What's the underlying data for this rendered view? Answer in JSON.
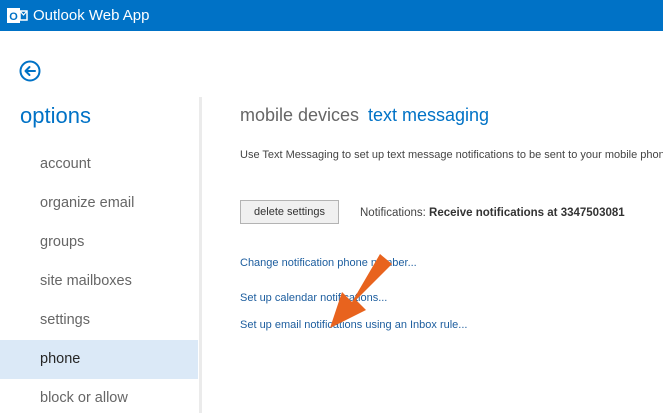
{
  "app": {
    "title": "Outlook Web App",
    "logo": "outlook-logo",
    "brand_color": "#0072c6"
  },
  "back": {
    "icon": "back-arrow-icon"
  },
  "sidebar": {
    "title": "options",
    "items": [
      {
        "label": "account",
        "selected": false
      },
      {
        "label": "organize email",
        "selected": false
      },
      {
        "label": "groups",
        "selected": false
      },
      {
        "label": "site mailboxes",
        "selected": false
      },
      {
        "label": "settings",
        "selected": false
      },
      {
        "label": "phone",
        "selected": true
      },
      {
        "label": "block or allow",
        "selected": false
      }
    ],
    "selected_color": "#dbe9f7"
  },
  "main": {
    "tabs": [
      {
        "label": "mobile devices",
        "active": false
      },
      {
        "label": "text messaging",
        "active": true
      }
    ],
    "intro": "Use Text Messaging to set up text message notifications to be sent to your mobile phone.",
    "delete_button": "delete settings",
    "notifications_label": "Notifications:",
    "notifications_value": "Receive notifications at 3347503081",
    "links": {
      "change_number": "Change notification phone number...",
      "calendar": "Set up calendar notifications...",
      "email": "Set up email notifications using an Inbox rule..."
    },
    "link_color": "#1c5d9e"
  },
  "annotation": {
    "icon": "pointer-arrow-icon",
    "color": "#e8631e"
  }
}
